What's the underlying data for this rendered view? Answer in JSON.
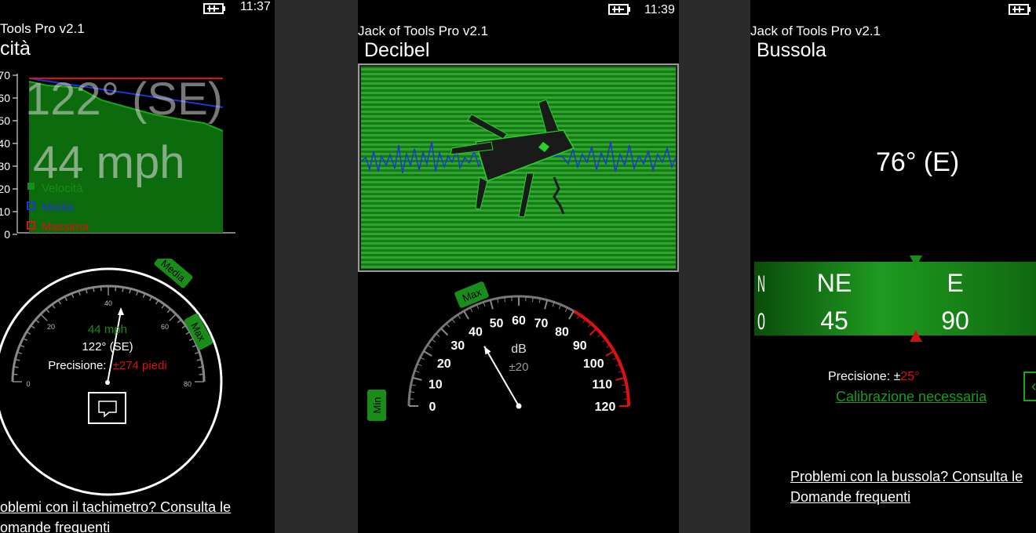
{
  "screen1": {
    "time": "11:37",
    "app_title": "Tools Pro v2.1",
    "page_title": "cità",
    "heading_overlay": "122° (SE)",
    "speed_overlay": "44 mph",
    "y_ticks": [
      "70",
      "60",
      "50",
      "40",
      "30",
      "20",
      "10",
      "0"
    ],
    "legend": [
      {
        "label": "Velocità",
        "color": "#1a8c1a"
      },
      {
        "label": "Media",
        "color": "#1e36d8"
      },
      {
        "label": "Massima",
        "color": "#dd1111"
      }
    ],
    "gauge_ticks": [
      "0",
      "20",
      "40",
      "60",
      "80"
    ],
    "gauge_speed": "44 mph",
    "gauge_heading": "122° (SE)",
    "precision_label": "Precisione:",
    "precision_value": "±274 piedi",
    "tag_media": "Media",
    "tag_max": "Max",
    "faq_line1": "oblemi con il tachimetro? Consulta le",
    "faq_line2": "omande frequenti",
    "colors": {
      "green": "#1a8c1a",
      "red": "#dd1111",
      "blue": "#1e36d8"
    }
  },
  "screen2": {
    "time": "11:39",
    "app_title": "Jack of Tools Pro v2.1",
    "page_title": "Decibel",
    "gauge_ticks": [
      "0",
      "10",
      "20",
      "30",
      "40",
      "50",
      "60",
      "70",
      "80",
      "90",
      "100",
      "110",
      "120"
    ],
    "unit": "dB",
    "error": "±20",
    "tag_max": "Max",
    "tag_min": "Min",
    "needle_value": 40,
    "colors": {
      "stripe_light": "#2da62d",
      "stripe_dark": "#177a17",
      "needle_red": "#dd1111"
    }
  },
  "screen3": {
    "app_title": "Jack of Tools Pro v2.1",
    "page_title": "Bussola",
    "heading": "76° (E)",
    "strip_labels": [
      "N",
      "NE",
      "E"
    ],
    "strip_degrees": [
      "0",
      "45",
      "90"
    ],
    "precision_label": "Precisione: ±",
    "precision_value": "25°",
    "calibration": "Calibrazione necessaria",
    "faq_line1": "Problemi con la bussola? Consulta le",
    "faq_line2": "Domande frequenti"
  }
}
